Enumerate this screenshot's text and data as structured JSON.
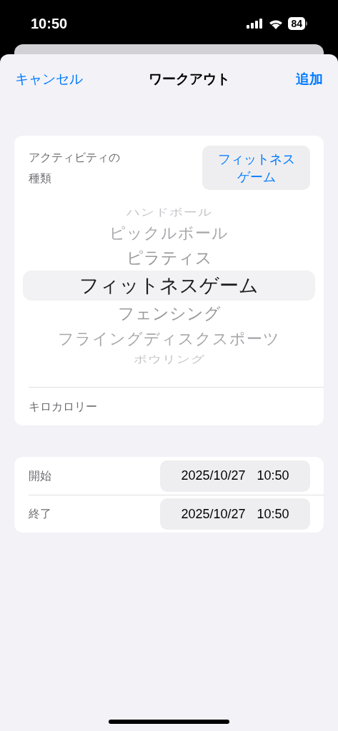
{
  "status_bar": {
    "time": "10:50",
    "battery": "84"
  },
  "nav": {
    "cancel": "キャンセル",
    "title": "ワークアウト",
    "add": "追加"
  },
  "activity": {
    "label": "アクティビティの種類",
    "value": "フィットネスゲーム"
  },
  "picker": [
    {
      "label": "ハンドボール",
      "selected": false
    },
    {
      "label": "ピックルボール",
      "selected": false
    },
    {
      "label": "ピラティス",
      "selected": false
    },
    {
      "label": "フィットネスゲーム",
      "selected": true
    },
    {
      "label": "フェンシング",
      "selected": false
    },
    {
      "label": "フライングディスクスポーツ",
      "selected": false
    },
    {
      "label": "ボウリング",
      "selected": false
    }
  ],
  "calories": {
    "label": "キロカロリー"
  },
  "times": [
    {
      "label": "開始",
      "date": "2025/10/27",
      "time": "10:50"
    },
    {
      "label": "終了",
      "date": "2025/10/27",
      "time": "10:50"
    }
  ]
}
